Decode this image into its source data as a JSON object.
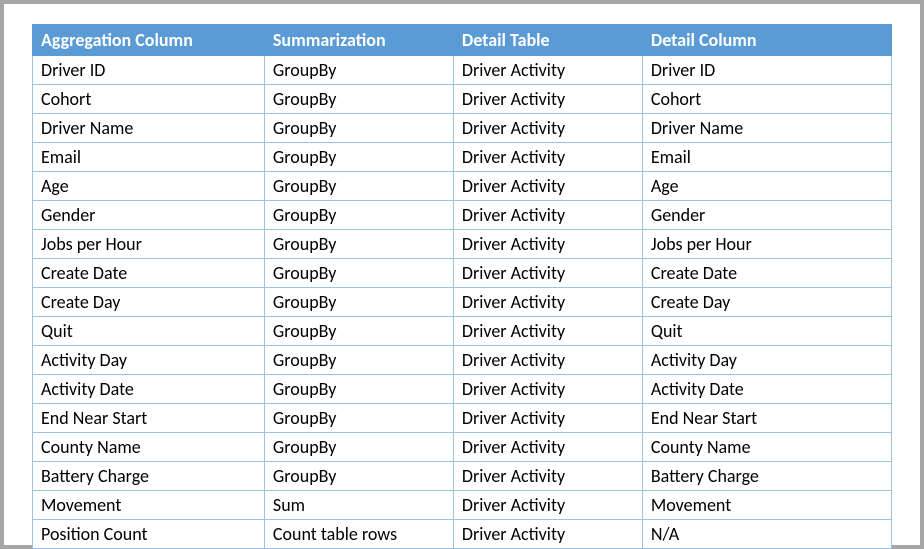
{
  "table": {
    "headers": [
      "Aggregation Column",
      "Summarization",
      "Detail Table",
      "Detail Column"
    ],
    "rows": [
      [
        "Driver ID",
        "GroupBy",
        "Driver Activity",
        "Driver ID"
      ],
      [
        "Cohort",
        "GroupBy",
        "Driver Activity",
        "Cohort"
      ],
      [
        "Driver Name",
        "GroupBy",
        "Driver Activity",
        "Driver Name"
      ],
      [
        "Email",
        "GroupBy",
        "Driver Activity",
        "Email"
      ],
      [
        "Age",
        "GroupBy",
        "Driver Activity",
        "Age"
      ],
      [
        "Gender",
        "GroupBy",
        "Driver Activity",
        "Gender"
      ],
      [
        "Jobs per Hour",
        "GroupBy",
        "Driver Activity",
        "Jobs per Hour"
      ],
      [
        "Create Date",
        "GroupBy",
        "Driver Activity",
        "Create Date"
      ],
      [
        "Create Day",
        "GroupBy",
        "Driver Activity",
        "Create Day"
      ],
      [
        "Quit",
        "GroupBy",
        "Driver Activity",
        "Quit"
      ],
      [
        "Activity Day",
        "GroupBy",
        "Driver Activity",
        "Activity Day"
      ],
      [
        "Activity Date",
        "GroupBy",
        "Driver Activity",
        "Activity Date"
      ],
      [
        "End Near Start",
        "GroupBy",
        "Driver Activity",
        "End Near Start"
      ],
      [
        "County Name",
        "GroupBy",
        "Driver Activity",
        "County Name"
      ],
      [
        "Battery Charge",
        "GroupBy",
        "Driver Activity",
        "Battery Charge"
      ],
      [
        "Movement",
        "Sum",
        "Driver Activity",
        "Movement"
      ],
      [
        "Position Count",
        "Count table rows",
        "Driver Activity",
        "N/A"
      ]
    ]
  }
}
